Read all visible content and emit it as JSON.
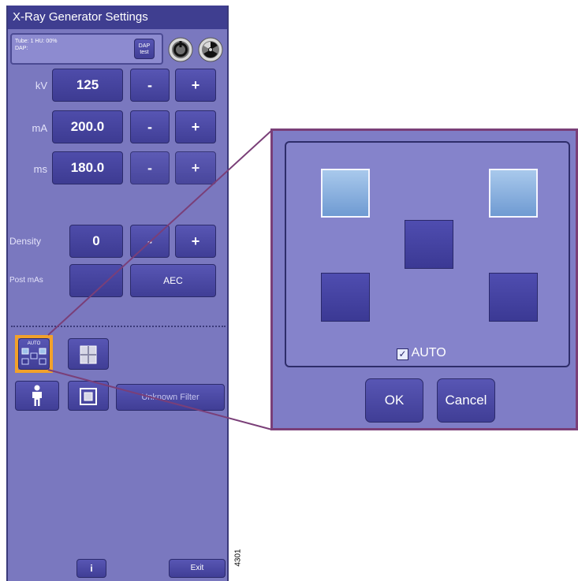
{
  "window": {
    "title": "X-Ray Generator Settings"
  },
  "tube_status": {
    "line1": "Tube: 1   HU: 00%",
    "line2": "DAP:",
    "dap_test_label": "DAP\ntest"
  },
  "parameters": [
    {
      "label": "kV",
      "value": "125",
      "minus": "-",
      "plus": "+"
    },
    {
      "label": "mA",
      "value": "200.0",
      "minus": "-",
      "plus": "+"
    },
    {
      "label": "ms",
      "value": "180.0",
      "minus": "-",
      "plus": "+"
    }
  ],
  "density": {
    "label": "Density",
    "value": "0",
    "minus": "-",
    "plus": "+"
  },
  "post_mas": {
    "label": "Post mAs",
    "value": "",
    "aec_label": "AEC"
  },
  "auto_chamber_button": {
    "label": "AUTO"
  },
  "filter_button": {
    "label": "Unknown Filter"
  },
  "bottom_bar": {
    "info_label": "i",
    "exit_label": "Exit"
  },
  "chamber_dialog": {
    "auto_label": "AUTO",
    "auto_checked": true,
    "ok_label": "OK",
    "cancel_label": "Cancel",
    "chambers": [
      {
        "name": "top-left",
        "selected": true
      },
      {
        "name": "top-right",
        "selected": true
      },
      {
        "name": "center",
        "selected": false
      },
      {
        "name": "bottom-left",
        "selected": false
      },
      {
        "name": "bottom-right",
        "selected": false
      }
    ]
  },
  "figure_id": "4301",
  "colors": {
    "panel": "#7a78bf",
    "button": "#4a48a4",
    "highlight": "#f2a12a",
    "selected_chamber": "#8fb6e3"
  }
}
